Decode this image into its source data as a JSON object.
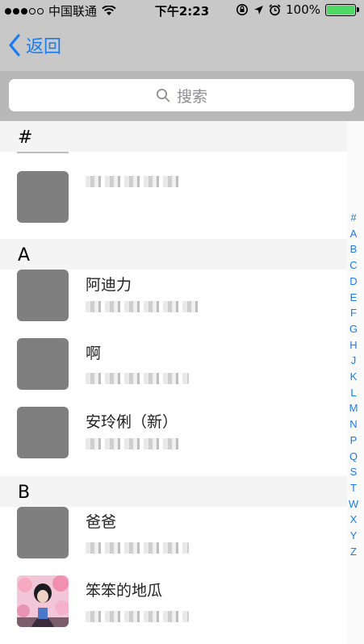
{
  "status_bar": {
    "carrier": "中国联通",
    "time": "下午2:23",
    "battery_percent": "100%",
    "signal_bars": 3,
    "signal_total": 5,
    "icons": [
      "wifi-icon",
      "rotation-lock-icon",
      "location-icon",
      "alarm-icon",
      "battery-icon"
    ],
    "battery_color": "#4cd964"
  },
  "nav": {
    "back_label": "返回",
    "accent_color": "#1a7cf0"
  },
  "search": {
    "placeholder": "搜索"
  },
  "sections": [
    {
      "letter": "#",
      "contacts": [
        {
          "name": "",
          "avatar": "gray-placeholder"
        }
      ]
    },
    {
      "letter": "A",
      "contacts": [
        {
          "name": "阿迪力",
          "avatar": "gray-placeholder"
        },
        {
          "name": "啊",
          "avatar": "gray-placeholder"
        },
        {
          "name": "安玲俐（新）",
          "avatar": "gray-placeholder"
        }
      ]
    },
    {
      "letter": "B",
      "contacts": [
        {
          "name": "爸爸",
          "avatar": "gray-placeholder"
        },
        {
          "name": "笨笨的地瓜",
          "avatar": "photo"
        }
      ]
    }
  ],
  "index_letters": [
    "#",
    "A",
    "B",
    "C",
    "D",
    "E",
    "F",
    "G",
    "H",
    "J",
    "K",
    "L",
    "M",
    "N",
    "P",
    "Q",
    "S",
    "T",
    "W",
    "X",
    "Y",
    "Z"
  ]
}
